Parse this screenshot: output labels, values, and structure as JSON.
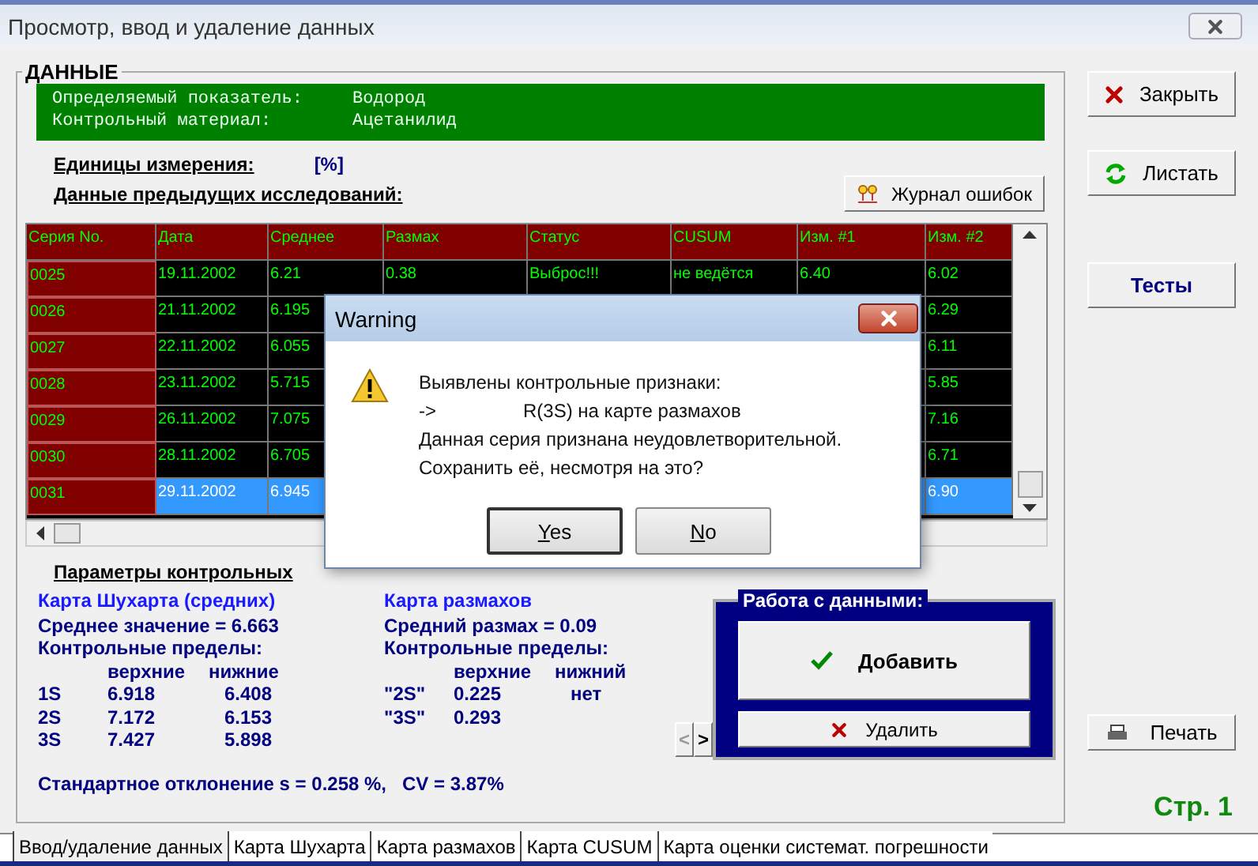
{
  "window": {
    "title": "Просмотр, ввод и удаление данных"
  },
  "data_group": {
    "legend": "ДАННЫЕ",
    "banner": [
      {
        "label": "Определяемый показатель:",
        "value": "Водород"
      },
      {
        "label": "Контрольный материал:",
        "value": "Ацетанилид"
      }
    ],
    "units_label": "Единицы измерения:",
    "units_value": "[%]",
    "previous_label": "Данные предыдущих исследований:",
    "journal_button": "Журнал ошибок"
  },
  "table": {
    "columns": [
      "Серия No.",
      "Дата",
      "Среднее",
      "Размах",
      "Статус",
      "CUSUM",
      "Изм. #1",
      "Изм. #2"
    ],
    "rows": [
      {
        "series": "0025",
        "date": "19.11.2002",
        "mean": "6.21",
        "range": "0.38",
        "status": "Выброс!!!",
        "cusum": "не ведётся",
        "meas_1": "6.40",
        "meas_2": "6.02",
        "selected": false
      },
      {
        "series": "0026",
        "date": "21.11.2002",
        "mean": "6.195",
        "meas_2": "6.29",
        "selected": false
      },
      {
        "series": "0027",
        "date": "22.11.2002",
        "mean": "6.055",
        "meas_2": "6.11",
        "selected": false
      },
      {
        "series": "0028",
        "date": "23.11.2002",
        "mean": "5.715",
        "meas_2": "5.85",
        "selected": false
      },
      {
        "series": "0029",
        "date": "26.11.2002",
        "mean": "7.075",
        "meas_2": "7.16",
        "selected": false
      },
      {
        "series": "0030",
        "date": "28.11.2002",
        "mean": "6.705",
        "meas_2": "6.71",
        "selected": false
      },
      {
        "series": "0031",
        "date": "29.11.2002",
        "mean": "6.945",
        "meas_2": "6.90",
        "selected": true
      }
    ]
  },
  "params": {
    "heading": "Параметры контрольных",
    "shewhart": {
      "title": "Карта Шухарта (средних)",
      "mean_line": "Среднее значение = 6.663",
      "limits_label": "Контрольные пределы:",
      "headers": [
        "верхние",
        "нижние"
      ],
      "rows": [
        {
          "label": "1S",
          "upper": "6.918",
          "lower": "6.408"
        },
        {
          "label": "2S",
          "upper": "7.172",
          "lower": "6.153"
        },
        {
          "label": "3S",
          "upper": "7.427",
          "lower": "5.898"
        }
      ]
    },
    "range": {
      "title": "Карта размахов",
      "mean_line": "Средний размах = 0.09",
      "limits_label": "Контрольные пределы:",
      "headers": [
        "верхние",
        "нижний"
      ],
      "rows": [
        {
          "label": "\"2S\"",
          "upper": "0.225",
          "lower": "нет"
        },
        {
          "label": "\"3S\"",
          "upper": "0.293"
        }
      ]
    },
    "std_line": "Стандартное отклонение s = 0.258 %,   CV = 3.87%"
  },
  "nav": [
    "<",
    ">"
  ],
  "work_panel": {
    "legend": "Работа с данными:",
    "add_button": "Добавить",
    "delete_button": "Удалить"
  },
  "side_buttons": [
    {
      "kind": "close",
      "label": "Закрыть"
    },
    {
      "kind": "browse",
      "label": "Листать"
    },
    {
      "kind": "tests",
      "label": "Тесты"
    }
  ],
  "print_button": "Печать",
  "page_label": "Стр. 1",
  "tabs": [
    {
      "label": "Ввод/удаление данных",
      "selected": true
    },
    {
      "label": "Карта Шухарта",
      "selected": false
    },
    {
      "label": "Карта размахов",
      "selected": false
    },
    {
      "label": "Карта CUSUM",
      "selected": false
    },
    {
      "label": "Карта оценки системат. погрешности",
      "selected": false
    }
  ],
  "dialog": {
    "title": "Warning",
    "lines": [
      "Выявлены контрольные признаки:",
      "Данная серия признана неудовлетворительной.",
      "Сохранить её, несмотря на это?"
    ],
    "arrow": "->",
    "rule": "R(3S) на карте размахов",
    "buttons": [
      {
        "label": "Yes",
        "selected": true
      },
      {
        "label": "No",
        "selected": false
      }
    ]
  }
}
